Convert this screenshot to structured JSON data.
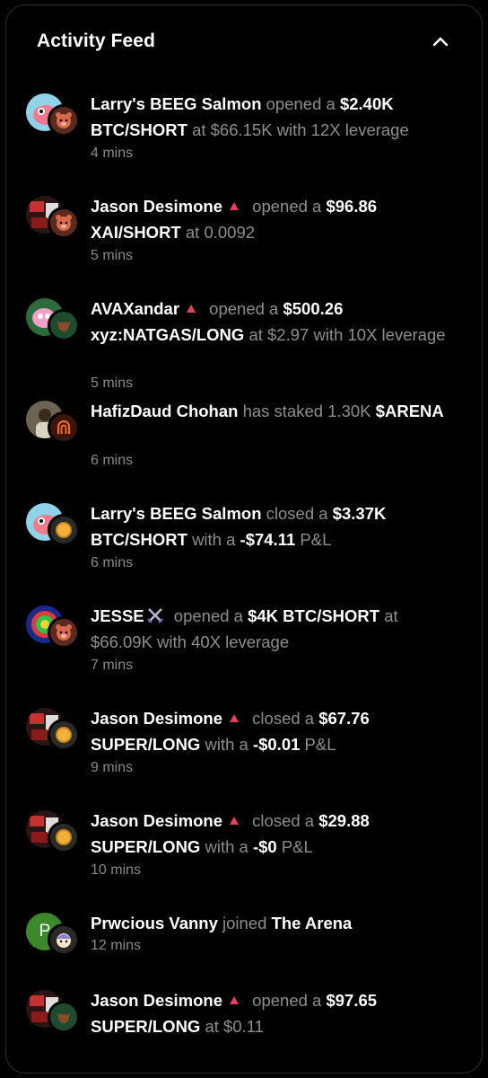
{
  "header": {
    "title": "Activity Feed"
  },
  "colors": {
    "background": "#000000",
    "text": "#ffffff",
    "muted": "#8e8e8e",
    "triangle": "#e8405c",
    "coin": "#f0b03a"
  },
  "feed": [
    {
      "name": "Larry's BEEG Salmon",
      "verb": "opened a",
      "amount": "$2.40K",
      "pair": "BTC/SHORT",
      "rest": "at $66.15K with 12X leverage",
      "time": "4 mins"
    },
    {
      "name": "Jason Desimone",
      "verb": "opened a",
      "amount": "$96.86",
      "pair": "XAI/SHORT",
      "rest": "at 0.0092",
      "time": "5 mins"
    },
    {
      "name": "AVAXandar",
      "verb": "opened a",
      "amount": "$500.26",
      "pair": "xyz:NATGAS/LONG",
      "rest": "at $2.97 with 10X leverage",
      "time": "5 mins"
    },
    {
      "name": "HafizDaud Chohan",
      "verb": "has staked 1.30K",
      "pair": "$ARENA",
      "time": "6 mins"
    },
    {
      "name": "Larry's BEEG Salmon",
      "verb": "closed a",
      "amount": "$3.37K",
      "pair": "BTC/SHORT",
      "rest1": "with a",
      "pnl": "-$74.11",
      "rest2": "P&L",
      "time": "6 mins"
    },
    {
      "name": "JESSE",
      "verb": "opened a",
      "amount": "$4K BTC/SHORT",
      "rest": "at $66.09K with 40X leverage",
      "time": "7 mins"
    },
    {
      "name": "Jason Desimone",
      "verb": "closed a",
      "amount": "$67.76",
      "pair": "SUPER/LONG",
      "rest1": "with a",
      "pnl": "-$0.01",
      "rest2": "P&L",
      "time": "9 mins"
    },
    {
      "name": "Jason Desimone",
      "verb": "closed a",
      "amount": "$29.88",
      "pair": "SUPER/LONG",
      "rest1": "with a",
      "pnl": "-$0",
      "rest2": "P&L",
      "time": "10 mins"
    },
    {
      "name": "Prwcious Vanny",
      "verb": "joined",
      "target": "The Arena",
      "initial": "P",
      "time": "12 mins"
    },
    {
      "name": "Jason Desimone",
      "verb": "opened a",
      "amount": "$97.65",
      "pair": "SUPER/LONG",
      "rest": "at $0.11"
    }
  ]
}
